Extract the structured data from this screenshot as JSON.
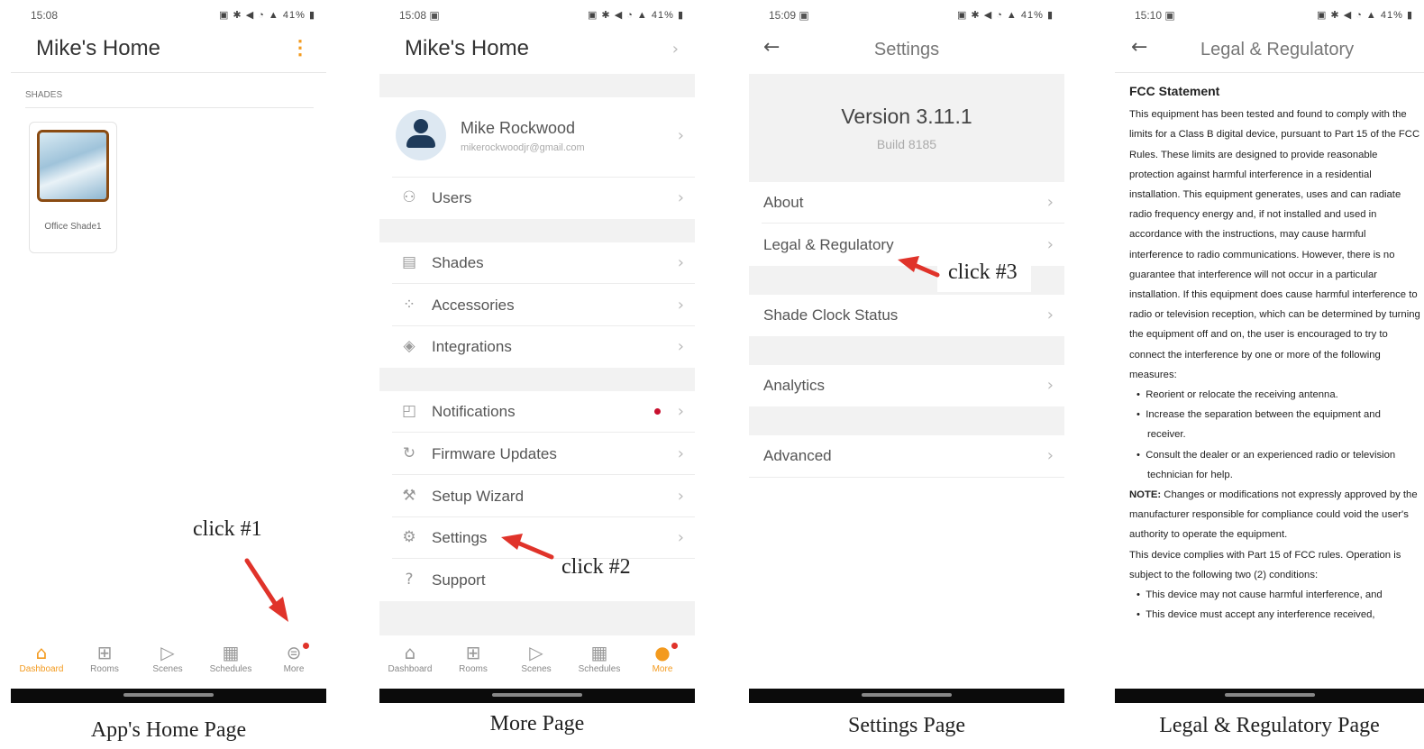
{
  "status_bar": {
    "p1": {
      "time": "15:08",
      "icons": "▣ ✱ ◀ ◔ ▲ 41% ▮"
    },
    "p2": {
      "time": "15:08 ▣",
      "icons": "▣ ✱ ◀ ◔ ▲ 41% ▮"
    },
    "p3": {
      "time": "15:09 ▣",
      "icons": "▣ ✱ ◀ ◔ ▲ 41% ▮"
    },
    "p4": {
      "time": "15:10 ▣",
      "icons": "▣ ✱ ◀ ◔ ▲ 41% ▮"
    }
  },
  "home": {
    "title": "Mike's Home",
    "menu_glyph": "⋮",
    "section_label": "SHADES",
    "shade_name": "Office Shade1"
  },
  "nav": [
    {
      "label": "Dashboard",
      "icon": "home-icon"
    },
    {
      "label": "Rooms",
      "icon": "rooms-icon"
    },
    {
      "label": "Scenes",
      "icon": "scenes-icon"
    },
    {
      "label": "Schedules",
      "icon": "schedules-icon"
    },
    {
      "label": "More",
      "icon": "more-icon"
    }
  ],
  "more": {
    "title": "Mike's Home",
    "user_name": "Mike Rockwood",
    "user_email": "mikerockwoodjr@gmail.com",
    "items": [
      {
        "label": "Users",
        "icon": "users-icon"
      },
      {
        "label": "Shades",
        "icon": "shades-icon"
      },
      {
        "label": "Accessories",
        "icon": "accessories-icon"
      },
      {
        "label": "Integrations",
        "icon": "integrations-icon"
      },
      {
        "label": "Notifications",
        "icon": "notifications-icon"
      },
      {
        "label": "Firmware Updates",
        "icon": "firmware-icon"
      },
      {
        "label": "Setup Wizard",
        "icon": "setup-wizard-icon"
      },
      {
        "label": "Settings",
        "icon": "gear-icon"
      },
      {
        "label": "Support",
        "icon": "support-icon"
      }
    ]
  },
  "settings": {
    "title": "Settings",
    "version": "Version 3.11.1",
    "build": "Build 8185",
    "items": [
      "About",
      "Legal & Regulatory",
      "Shade Clock Status",
      "Analytics",
      "Advanced"
    ]
  },
  "legal": {
    "title": "Legal & Regulatory",
    "heading": "FCC Statement",
    "paragraph": "This equipment has been tested and found to comply with the limits for a Class B digital device, pursuant to Part 15 of the FCC Rules. These limits are designed to provide reasonable protection against harmful interference in a residential installation. This equipment generates, uses and can radiate radio frequency energy and, if not installed and used in accordance with the instructions, may cause harmful interference to radio communications. However, there is no guarantee that interference will not occur in a particular installation. If this equipment does cause harmful interference to radio or television reception, which can be determined by turning the equipment off and on, the user is encouraged to try to connect the interference by one or more of the following measures:",
    "bullets": [
      "Reorient or relocate the receiving antenna.",
      "Increase the separation between the equipment and receiver.",
      "Consult the dealer or an experienced radio or television technician for help."
    ],
    "note_label": "NOTE:",
    "note_text": " Changes or modifications not expressly approved by the manufacturer responsible for compliance could void the user's authority to operate the equipment.",
    "complies": "This device complies with Part 15 of FCC rules. Operation is subject to the following two (2) conditions:",
    "conditions": [
      "This device may not cause harmful interference, and",
      "This device must accept any interference received,"
    ]
  },
  "annotations": {
    "click1": "click #1",
    "click2": "click #2",
    "click3": "click #3",
    "arrow_color": "#e0332a"
  },
  "captions": [
    "App's Home Page",
    "More Page",
    "Settings Page",
    "Legal & Regulatory Page"
  ],
  "colors": {
    "accent": "#f39a1e",
    "notification_dot": "#c8102e",
    "black_bar": "#0b0b0b"
  }
}
